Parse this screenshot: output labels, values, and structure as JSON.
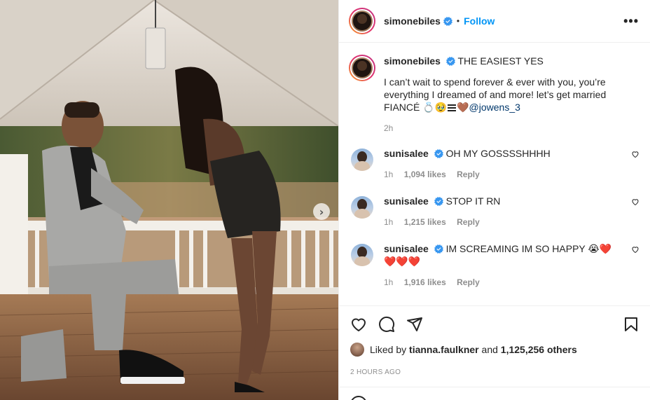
{
  "post": {
    "username": "simonebiles",
    "follow_label": "Follow",
    "separator": "•",
    "more_label": "•••"
  },
  "caption": {
    "username": "simonebiles",
    "title": "THE EASIEST YES",
    "body": "I can’t wait to spend forever & ever with you, you’re everything I dreamed of and more! let’s get married FIANCÉ 💍🥹",
    "emoji_tail": "🤎",
    "mention": "@jowens_3",
    "time": "2h"
  },
  "comments": [
    {
      "username": "sunisalee",
      "text": "OH MY GOSSSSHHHH",
      "time": "1h",
      "likes": "1,094 likes",
      "reply": "Reply"
    },
    {
      "username": "sunisalee",
      "text": "STOP IT RN",
      "time": "1h",
      "likes": "1,215 likes",
      "reply": "Reply"
    },
    {
      "username": "sunisalee",
      "text": "IM SCREAMING IM SO HAPPY 😭❤️❤️❤️❤️",
      "time": "1h",
      "likes": "1,916 likes",
      "reply": "Reply"
    }
  ],
  "likes": {
    "prefix": "Liked by",
    "user": "tianna.faulkner",
    "middle": "and",
    "others": "1,125,256 others"
  },
  "timestamp": "2 HOURS AGO",
  "icons": [
    "heart-icon",
    "comment-icon",
    "share-icon",
    "bookmark-icon",
    "more-icon",
    "verified-icon",
    "next-arrow-icon"
  ],
  "colors": {
    "accent": "#0095f6",
    "verified": "#3897f0",
    "text": "#262626",
    "muted": "#8e8e8e",
    "mention": "#00376b"
  },
  "next_arrow": "›"
}
